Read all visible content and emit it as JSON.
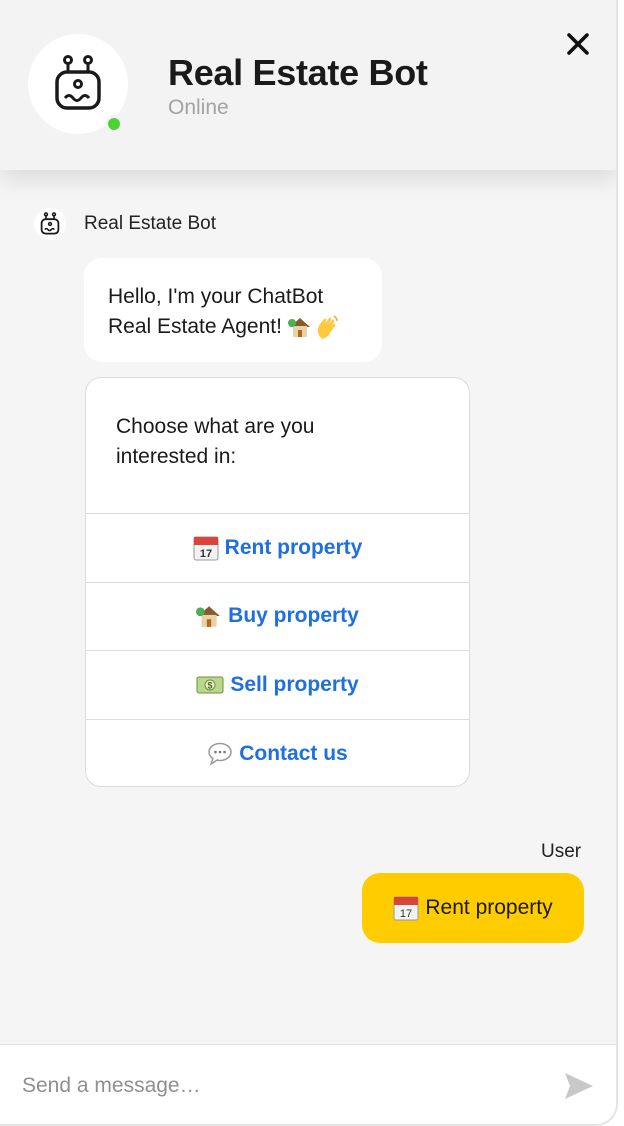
{
  "header": {
    "title": "Real Estate Bot",
    "status": "Online",
    "status_color": "#4cd137"
  },
  "messages": {
    "bot_sender_name": "Real Estate Bot",
    "bot_greeting_line1": "Hello, I'm your ChatBot",
    "bot_greeting_line2": "Real Estate Agent!",
    "card": {
      "prompt_line1": "Choose what are you",
      "prompt_line2": "interested in:",
      "options": [
        {
          "label": "Rent property",
          "icon": "calendar-icon"
        },
        {
          "label": "Buy property",
          "icon": "house-icon"
        },
        {
          "label": "Sell property",
          "icon": "money-icon"
        },
        {
          "label": "Contact us",
          "icon": "speech-bubble-icon"
        }
      ]
    },
    "user_sender_name": "User",
    "user_message": "Rent property",
    "user_message_icon": "calendar-icon"
  },
  "composer": {
    "placeholder": "Send a message…"
  },
  "colors": {
    "accent_link": "#1e6fe0",
    "user_bubble": "#ffcc00"
  }
}
